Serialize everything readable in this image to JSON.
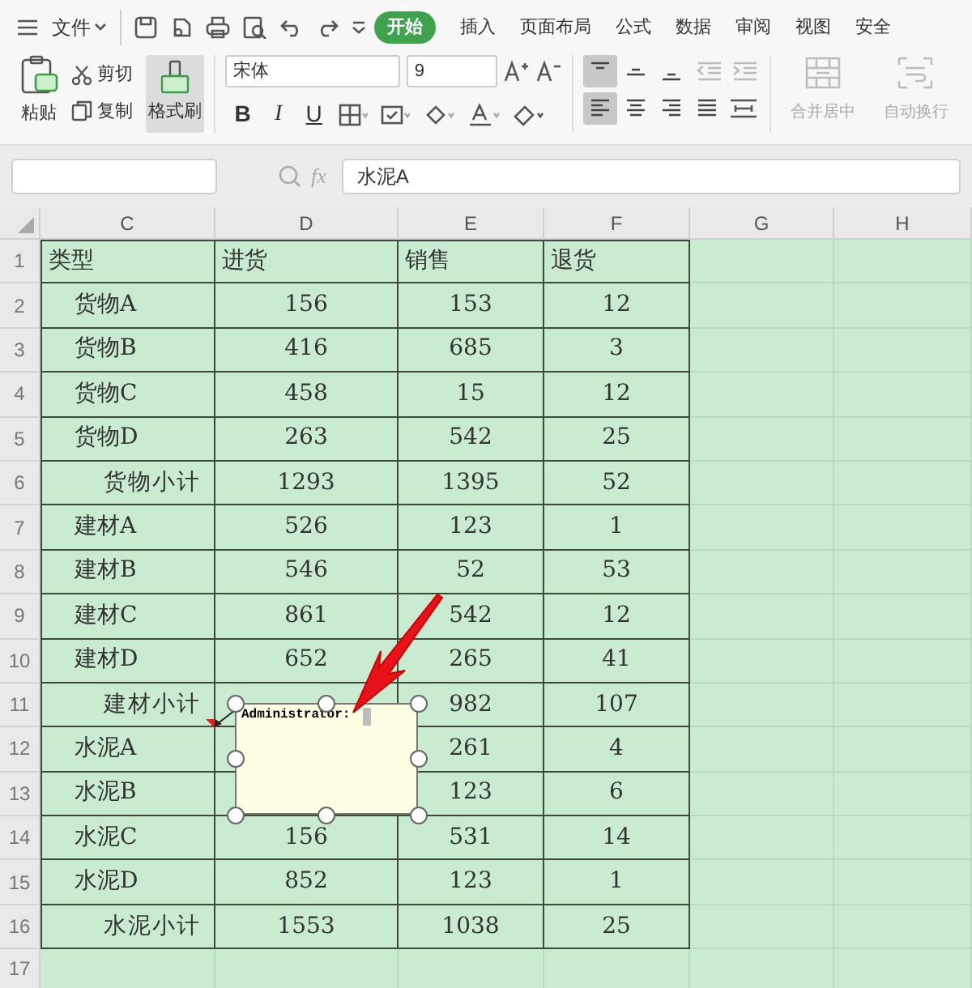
{
  "file_menu": {
    "label": "文件"
  },
  "ribbon_tabs": [
    {
      "label": "开始",
      "selected": true
    },
    {
      "label": "插入",
      "selected": false
    },
    {
      "label": "页面布局",
      "selected": false
    },
    {
      "label": "公式",
      "selected": false
    },
    {
      "label": "数据",
      "selected": false
    },
    {
      "label": "审阅",
      "selected": false
    },
    {
      "label": "视图",
      "selected": false
    },
    {
      "label": "安全",
      "selected": false
    }
  ],
  "clipboard": {
    "paste": "粘贴",
    "cut": "剪切",
    "copy": "复制",
    "format_painter": {
      "label": "格式刷",
      "selected": true
    }
  },
  "font": {
    "name": "宋体",
    "size": "9"
  },
  "font_buttons": [
    "B",
    "I",
    "U"
  ],
  "align_top": [
    {
      "selected": true
    },
    {
      "selected": false
    },
    {
      "selected": false
    }
  ],
  "align_horizontal": [
    {
      "selected": true
    },
    {
      "selected": false
    },
    {
      "selected": false
    },
    {
      "selected": false
    }
  ],
  "merge_button": {
    "label": "合并居中",
    "disabled": true
  },
  "wrap_button": {
    "label": "自动换行",
    "disabled": true
  },
  "formula_bar": {
    "function_label": "fx",
    "formula": "水泥A"
  },
  "columns": [
    "C",
    "D",
    "E",
    "F",
    "G",
    "H"
  ],
  "rows": [
    {
      "number": "1",
      "kind": "header",
      "cells": [
        "类型",
        "进货",
        "销售",
        "退货"
      ]
    },
    {
      "number": "2",
      "kind": "item",
      "cells": [
        "货物A",
        "156",
        "153",
        "12"
      ]
    },
    {
      "number": "3",
      "kind": "item",
      "cells": [
        "货物B",
        "416",
        "685",
        "3"
      ]
    },
    {
      "number": "4",
      "kind": "item",
      "cells": [
        "货物C",
        "458",
        "15",
        "12"
      ]
    },
    {
      "number": "5",
      "kind": "item",
      "cells": [
        "货物D",
        "263",
        "542",
        "25"
      ]
    },
    {
      "number": "6",
      "kind": "subtotal",
      "cells": [
        "货物小计",
        "1293",
        "1395",
        "52"
      ]
    },
    {
      "number": "7",
      "kind": "item",
      "cells": [
        "建材A",
        "526",
        "123",
        "1"
      ]
    },
    {
      "number": "8",
      "kind": "item",
      "cells": [
        "建材B",
        "546",
        "52",
        "53"
      ]
    },
    {
      "number": "9",
      "kind": "item",
      "cells": [
        "建材C",
        "861",
        "542",
        "12"
      ]
    },
    {
      "number": "10",
      "kind": "item",
      "cells": [
        "建材D",
        "652",
        "265",
        "41"
      ]
    },
    {
      "number": "11",
      "kind": "subtotal",
      "cells": [
        "建材小计",
        null,
        "982",
        "107"
      ]
    },
    {
      "number": "12",
      "kind": "item",
      "cells": [
        "水泥A",
        null,
        "261",
        "4"
      ]
    },
    {
      "number": "13",
      "kind": "item",
      "cells": [
        "水泥B",
        null,
        "123",
        "6"
      ]
    },
    {
      "number": "14",
      "kind": "item",
      "cells": [
        "水泥C",
        "156",
        "531",
        "14"
      ]
    },
    {
      "number": "15",
      "kind": "item",
      "cells": [
        "水泥D",
        "852",
        "123",
        "1"
      ]
    },
    {
      "number": "16",
      "kind": "subtotal",
      "cells": [
        "水泥小计",
        "1553",
        "1038",
        "25"
      ]
    },
    {
      "number": "17",
      "kind": "empty",
      "cells": []
    }
  ],
  "comment": {
    "author": "Administrator:"
  }
}
